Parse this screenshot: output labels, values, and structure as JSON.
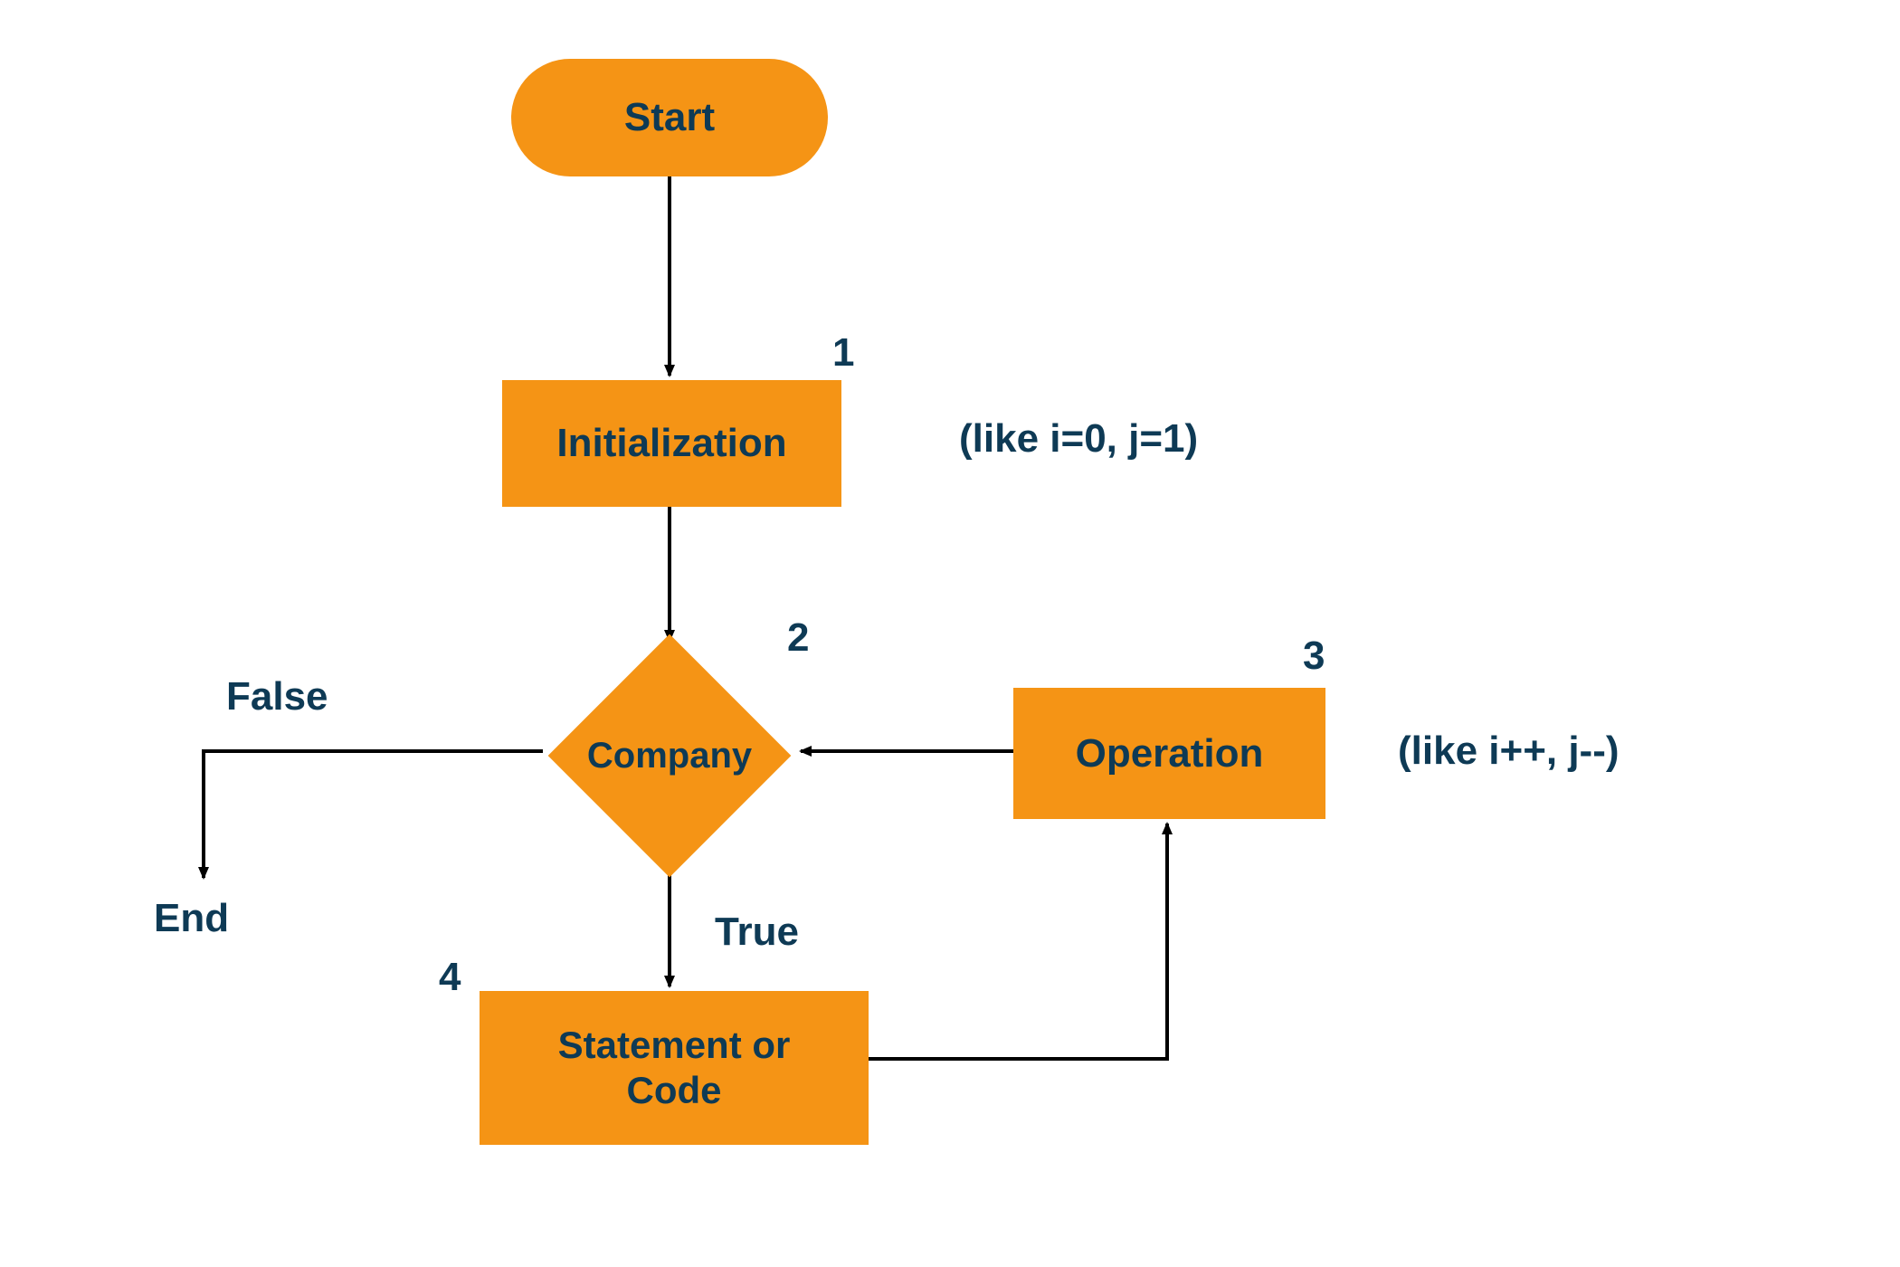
{
  "colors": {
    "fill": "#f59415",
    "text": "#0e3a55",
    "stroke": "#000000",
    "bg": "#ffffff"
  },
  "nodes": {
    "start": {
      "label": "Start",
      "number": null
    },
    "init": {
      "label": "Initialization",
      "number": "1"
    },
    "condition": {
      "label": "Company",
      "number": "2"
    },
    "operation": {
      "label": "Operation",
      "number": "3"
    },
    "statement": {
      "label": "Statement or\nCode",
      "number": "4"
    }
  },
  "annotations": {
    "init_note": "(like i=0, j=1)",
    "operation_note": "(like i++, j--)"
  },
  "edges": {
    "condition_true": "True",
    "condition_false": "False",
    "end": "End"
  }
}
